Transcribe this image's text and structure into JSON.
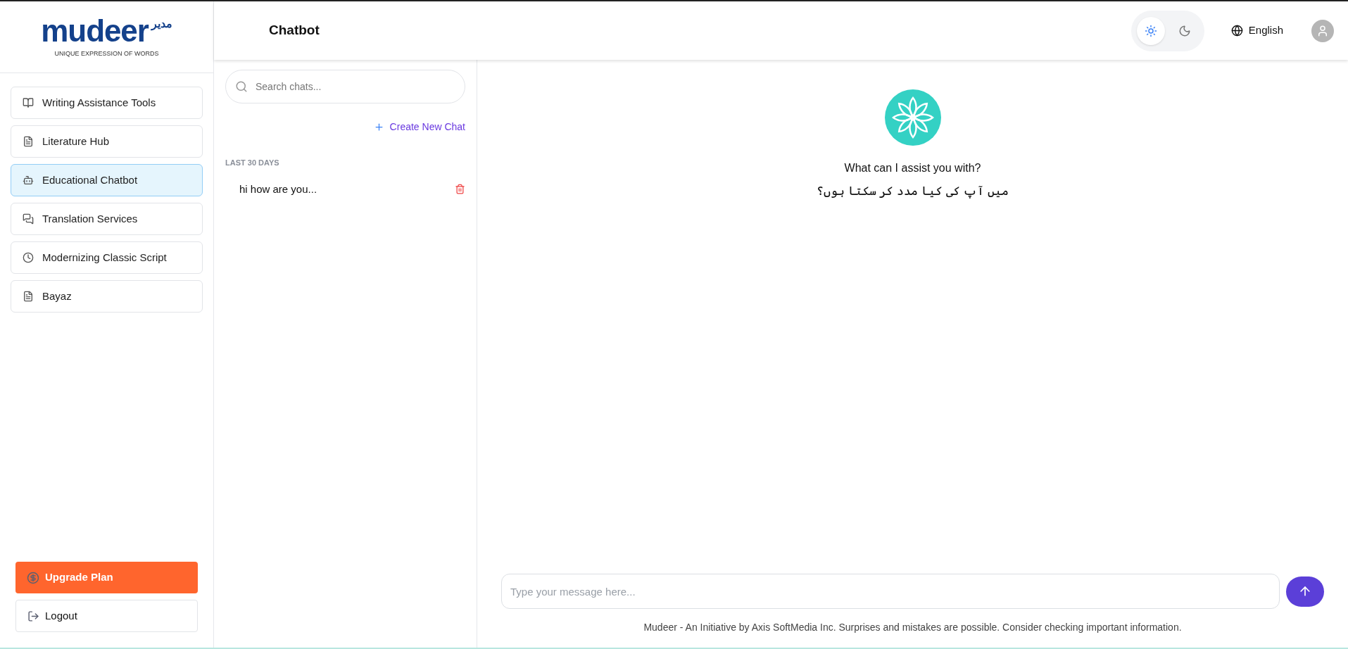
{
  "logo": {
    "name": "mudeer",
    "urdu": "مدیر",
    "tagline": "UNIQUE EXPRESSION OF WORDS"
  },
  "sidebar": {
    "items": [
      {
        "label": "Writing Assistance Tools",
        "selected": false
      },
      {
        "label": "Literature Hub",
        "selected": false
      },
      {
        "label": "Educational Chatbot",
        "selected": true
      },
      {
        "label": "Translation Services",
        "selected": false
      },
      {
        "label": "Modernizing Classic Script",
        "selected": false
      },
      {
        "label": "Bayaz",
        "selected": false
      }
    ],
    "upgrade": "Upgrade Plan",
    "logout": "Logout"
  },
  "header": {
    "title": "Chatbot",
    "theme_toggle": [
      {
        "kind": "light",
        "selected": true
      },
      {
        "kind": "dark",
        "selected": false
      }
    ],
    "language": "English"
  },
  "chat_list": {
    "search": {
      "placeholder": "Search chats..."
    },
    "new_chat": "Create New Chat",
    "section": "LAST 30 DAYS",
    "chats": [
      {
        "title": "hi how are you..."
      }
    ]
  },
  "chat": {
    "greeting": "What can I assist you with?",
    "greeting_urdu": "میں آپ کی کیا مدد کر سکتا ہوں؟",
    "input": {
      "placeholder": "Type your message here..."
    },
    "disclaimer": "Mudeer - An Initiative by Axis SoftMedia Inc. Surprises and mistakes are possible. Consider checking important information."
  }
}
